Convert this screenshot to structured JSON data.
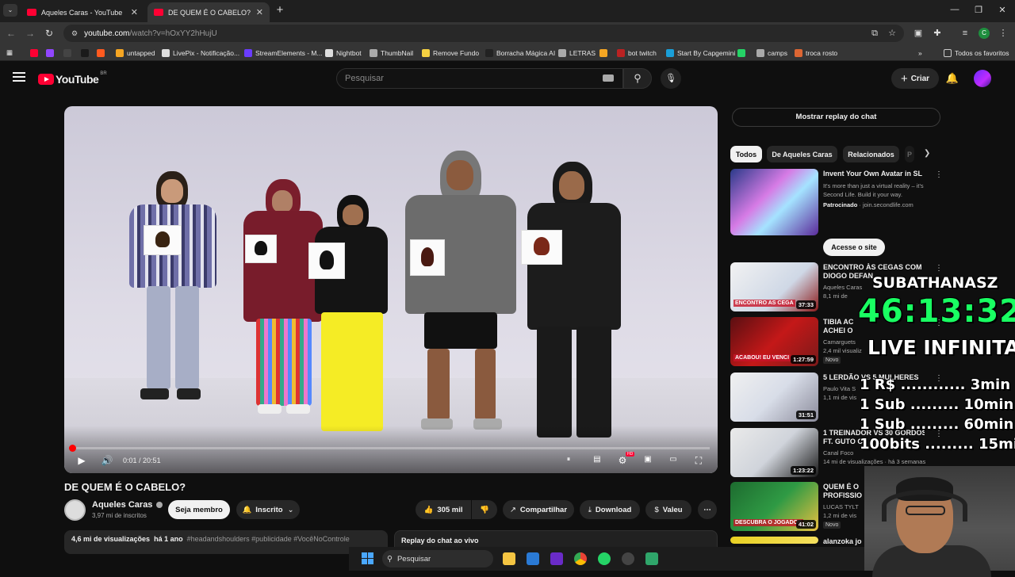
{
  "browser": {
    "tabs": [
      {
        "title": "Aqueles Caras - YouTube",
        "active": false
      },
      {
        "title": "DE QUEM É O CABELO? - YouTube",
        "active": true
      }
    ],
    "url_host": "youtube.com",
    "url_path": "/watch?v=hOxYY2hHujU",
    "profile_initial": "C",
    "bookmarks": [
      {
        "label": "",
        "color": "#ff0033"
      },
      {
        "label": "",
        "color": "#9146ff"
      },
      {
        "label": "",
        "color": "#444444"
      },
      {
        "label": "",
        "color": "#1a1a1a"
      },
      {
        "label": "",
        "color": "#ff5a1f"
      },
      {
        "label": "untapped",
        "color": "#f5a623"
      },
      {
        "label": "LivePix - Notificação...",
        "color": "#dddddd"
      },
      {
        "label": "StreamElements - M...",
        "color": "#6a3cff"
      },
      {
        "label": "Nightbot",
        "color": "#dddddd"
      },
      {
        "label": "ThumbNail",
        "color": "#aaaaaa"
      },
      {
        "label": "Remove Fundo",
        "color": "#f5d142"
      },
      {
        "label": "Borracha Mágica AI",
        "color": "#222222"
      },
      {
        "label": "LETRAS",
        "color": "#aaaaaa"
      },
      {
        "label": "",
        "color": "#f5a623"
      },
      {
        "label": "bot twitch",
        "color": "#bb2222"
      },
      {
        "label": "Start By Capgemini",
        "color": "#1a9fd8"
      },
      {
        "label": "",
        "color": "#25d366"
      },
      {
        "label": "camps",
        "color": "#aaaaaa"
      },
      {
        "label": "troca rosto",
        "color": "#dd6633"
      }
    ],
    "all_bookmarks": "Todos os favoritos"
  },
  "youtube": {
    "logo_text": "YouTube",
    "logo_region": "BR",
    "search_placeholder": "Pesquisar",
    "create_label": "Criar"
  },
  "video": {
    "title": "DE QUEM É O CABELO?",
    "time_current": "0:01",
    "time_total": "20:51",
    "progress": 0.001,
    "hd_label": "HD",
    "channel": "Aqueles Caras",
    "subscribers": "3,97 mi de inscritos",
    "join_label": "Seja membro",
    "subscribed_label": "Inscrito",
    "likes": "305 mil",
    "share_label": "Compartilhar",
    "download_label": "Download",
    "thanks_label": "Valeu",
    "views": "4,6 mi de visualizações",
    "age": "há 1 ano",
    "hashtags": "#headandshoulders #publicidade #VocêNoControle",
    "chat_replay_label": "Replay do chat ao vivo"
  },
  "sidebar": {
    "show_chat_label": "Mostrar replay do chat",
    "chips": [
      "Todos",
      "De Aqueles Caras",
      "Relacionados",
      "P"
    ],
    "ad": {
      "title": "Invent Your Own Avatar in SL",
      "description": "It's more than just a virtual reality – it's Second Life. Build it your way.",
      "sponsored_label": "Patrocinado",
      "sponsored_domain": "join.secondlife.com",
      "cta": "Acesse o site"
    },
    "recommendations": [
      {
        "title_l1": "ENCONTRO ÀS CEGAS COM",
        "title_l2": "DIOGO DEFAN",
        "channel": "Aqueles Caras",
        "meta": "8,1 mi de",
        "badge": "",
        "duration": "37:33",
        "thumb_text": "ENCONTRO AS CEGA"
      },
      {
        "title_l1": "TIBIA AC",
        "title_l2": "ACHEI O",
        "channel": "Camarguets",
        "meta": "2,4 mil visualiz",
        "badge": "Novo",
        "duration": "1:27:59",
        "thumb_text": "ACABOU! EU VENCI"
      },
      {
        "title_l1": "5 LERDÃO VS 5 MULHERES",
        "title_l2": "",
        "channel": "Paulo Vita S",
        "meta": "1,1 mi de vis",
        "badge": "",
        "duration": "31:51",
        "thumb_text": ""
      },
      {
        "title_l1": "1 TREINADOR VS 30 GORDOS",
        "title_l2": "FT. GUTO C",
        "channel": "Canal Foco",
        "meta": "14 mi de visualizações · há 3 semanas",
        "badge": "",
        "duration": "1:23:22",
        "thumb_text": ""
      },
      {
        "title_l1": "QUEM É O",
        "title_l2": "PROFISSIO",
        "channel": "LUCAS TYLT",
        "meta": "1,2 mi de vis",
        "badge": "Novo",
        "duration": "41:02",
        "thumb_text": "DESCUBRA O JOGADOR"
      },
      {
        "title_l1": "alanzoka jo",
        "title_l2": "",
        "channel": "",
        "meta": "",
        "badge": "",
        "duration": "",
        "thumb_text": ""
      }
    ]
  },
  "overlay": {
    "subathon_label": "SUBATHANASZ",
    "timer": "46:13:32",
    "live_label": "LIVE INFINITA",
    "rules": [
      {
        "left": "1 R$",
        "right": "3min"
      },
      {
        "left": "1 Sub",
        "right": "10min"
      },
      {
        "left": "1 Sub",
        "right": "60min"
      },
      {
        "left": "100bits",
        "right": "15min"
      }
    ]
  },
  "taskbar": {
    "search_placeholder": "Pesquisar"
  }
}
